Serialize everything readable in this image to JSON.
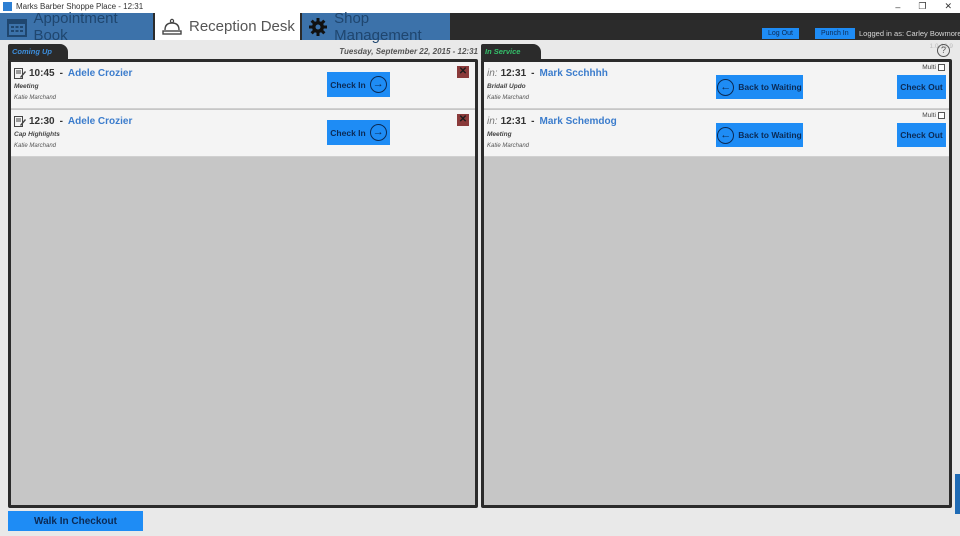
{
  "window": {
    "title": "Marks Barber Shoppe Place - 12:31",
    "controls": [
      "–",
      "❐",
      "✕"
    ]
  },
  "nav": {
    "tabs": [
      {
        "label": "Appointment Book",
        "icon": "calendar-icon"
      },
      {
        "label": "Reception Desk",
        "icon": "desk-bell-icon"
      },
      {
        "label": "Shop Management",
        "icon": "gear-icon"
      }
    ],
    "active_tab": "Reception Desk",
    "logout_label": "Log Out",
    "punch_label": "Punch In",
    "logged_in_text": "Logged in as: Carley Bowmore",
    "version": "1.0.12.9"
  },
  "coming_up": {
    "tab_label": "Coming Up",
    "date_text": "Tuesday, September 22, 2015 - 12:31",
    "appointments": [
      {
        "time": "10:45",
        "client": "Adele Crozier",
        "service": "Meeting",
        "stylist": "Katie Marchand",
        "checkin_label": "Check In"
      },
      {
        "time": "12:30",
        "client": "Adele Crozier",
        "service": "Cap Highlights",
        "stylist": "Katie Marchand",
        "checkin_label": "Check In"
      }
    ]
  },
  "in_service": {
    "tab_label": "In Service",
    "help": "?",
    "in_prefix": "in:",
    "items": [
      {
        "time": "12:31",
        "client": "Mark Scchhhh",
        "service": "Bridall Updo",
        "stylist": "Katie Marchand",
        "back_label": "Back to Waiting",
        "checkout_label": "Check Out",
        "multi_label": "Multi"
      },
      {
        "time": "12:31",
        "client": "Mark Schemdog",
        "service": "Meeting",
        "stylist": "Katie Marchand",
        "back_label": "Back to Waiting",
        "checkout_label": "Check Out",
        "multi_label": "Multi"
      }
    ]
  },
  "footer": {
    "walk_in_label": "Walk In Checkout"
  },
  "colors": {
    "accent": "#1e8cf5",
    "nav_bg": "#2b2b2b",
    "tab_blue": "#3c72aa",
    "name_blue": "#3b7ccc",
    "in_service_green": "#34c26b"
  }
}
